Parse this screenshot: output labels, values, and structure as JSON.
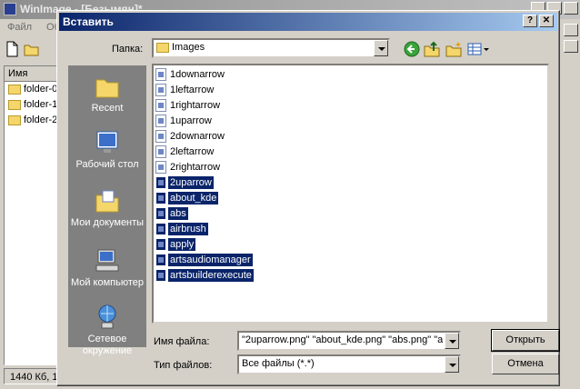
{
  "background_app": {
    "title": "WinImage - [Безымян]*",
    "menu": [
      "Файл",
      "Обр"
    ],
    "column_header": "Имя",
    "items": [
      "folder-0",
      "folder-1",
      "folder-2"
    ],
    "status": "1440 Кб, 1"
  },
  "dialog": {
    "title": "Вставить",
    "help_button": "?",
    "close_button": "✕",
    "folder_label": "Папка:",
    "folder_value": "Images",
    "places": [
      {
        "label": "Recent",
        "icon": "recent-folder-icon"
      },
      {
        "label": "Рабочий стол",
        "icon": "desktop-icon"
      },
      {
        "label": "Мои документы",
        "icon": "my-documents-icon"
      },
      {
        "label": "Мой компьютер",
        "icon": "my-computer-icon"
      },
      {
        "label": "Сетевое окружение",
        "icon": "network-icon"
      }
    ],
    "files": [
      {
        "name": "1downarrow",
        "selected": false
      },
      {
        "name": "1leftarrow",
        "selected": false
      },
      {
        "name": "1rightarrow",
        "selected": false
      },
      {
        "name": "1uparrow",
        "selected": false
      },
      {
        "name": "2downarrow",
        "selected": false
      },
      {
        "name": "2leftarrow",
        "selected": false
      },
      {
        "name": "2rightarrow",
        "selected": false
      },
      {
        "name": "2uparrow",
        "selected": true
      },
      {
        "name": "about_kde",
        "selected": true
      },
      {
        "name": "abs",
        "selected": true
      },
      {
        "name": "airbrush",
        "selected": true
      },
      {
        "name": "apply",
        "selected": true
      },
      {
        "name": "artsaudiomanager",
        "selected": true
      },
      {
        "name": "artsbuilderexecute",
        "selected": true
      }
    ],
    "filename_label": "Имя файла:",
    "filename_value": "\"2uparrow.png\" \"about_kde.png\" \"abs.png\" \"a",
    "filetype_label": "Тип файлов:",
    "filetype_value": "Все файлы (*.*)",
    "open_button": "Открыть",
    "cancel_button": "Отмена"
  },
  "colors": {
    "title_active": "#0a246a",
    "selection": "#0a246a",
    "face": "#d4d0c8",
    "places_bar": "#808080"
  }
}
